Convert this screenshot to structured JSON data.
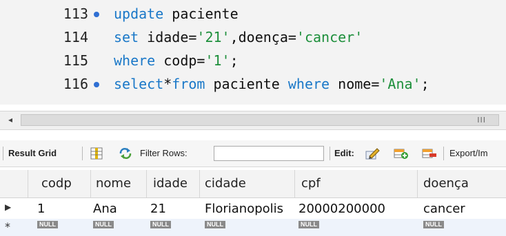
{
  "editor": {
    "lines": [
      {
        "num": "113",
        "dot": true,
        "parts": [
          {
            "t": "kw",
            "v": "update"
          },
          {
            "t": "tx",
            "v": " paciente"
          }
        ]
      },
      {
        "num": "114",
        "dot": false,
        "parts": [
          {
            "t": "kw",
            "v": "set"
          },
          {
            "t": "tx",
            "v": " idade="
          },
          {
            "t": "st",
            "v": "'21'"
          },
          {
            "t": "tx",
            "v": ",doença="
          },
          {
            "t": "st",
            "v": "'cancer'"
          }
        ]
      },
      {
        "num": "115",
        "dot": false,
        "parts": [
          {
            "t": "kw",
            "v": "where"
          },
          {
            "t": "tx",
            "v": " codp="
          },
          {
            "t": "st",
            "v": "'1'"
          },
          {
            "t": "tx",
            "v": ";"
          }
        ]
      },
      {
        "num": "116",
        "dot": true,
        "parts": [
          {
            "t": "kw",
            "v": "select"
          },
          {
            "t": "tx",
            "v": "*"
          },
          {
            "t": "kw",
            "v": "from"
          },
          {
            "t": "tx",
            "v": " paciente "
          },
          {
            "t": "kw",
            "v": "where"
          },
          {
            "t": "tx",
            "v": " nome="
          },
          {
            "t": "st",
            "v": "'Ana'"
          },
          {
            "t": "tx",
            "v": ";"
          }
        ]
      }
    ]
  },
  "scrollbar": {
    "left_arrow": "◂",
    "grip": "III"
  },
  "toolbar": {
    "result_grid": "Result Grid",
    "filter_rows": "Filter Rows:",
    "filter_value": "",
    "edit": "Edit:",
    "export": "Export/Im"
  },
  "grid": {
    "columns": [
      "codp",
      "nome",
      "idade",
      "cidade",
      "cpf",
      "doença"
    ],
    "rows": [
      [
        "1",
        "Ana",
        "21",
        "Florianopolis",
        "20000200000",
        "cancer"
      ]
    ],
    "null_label": "NULL",
    "current_row_marker": "▶",
    "new_row_marker": "*"
  },
  "colors": {
    "keyword": "#1a78c8",
    "string": "#1d8f3b",
    "marker": "#2f6fd3"
  }
}
